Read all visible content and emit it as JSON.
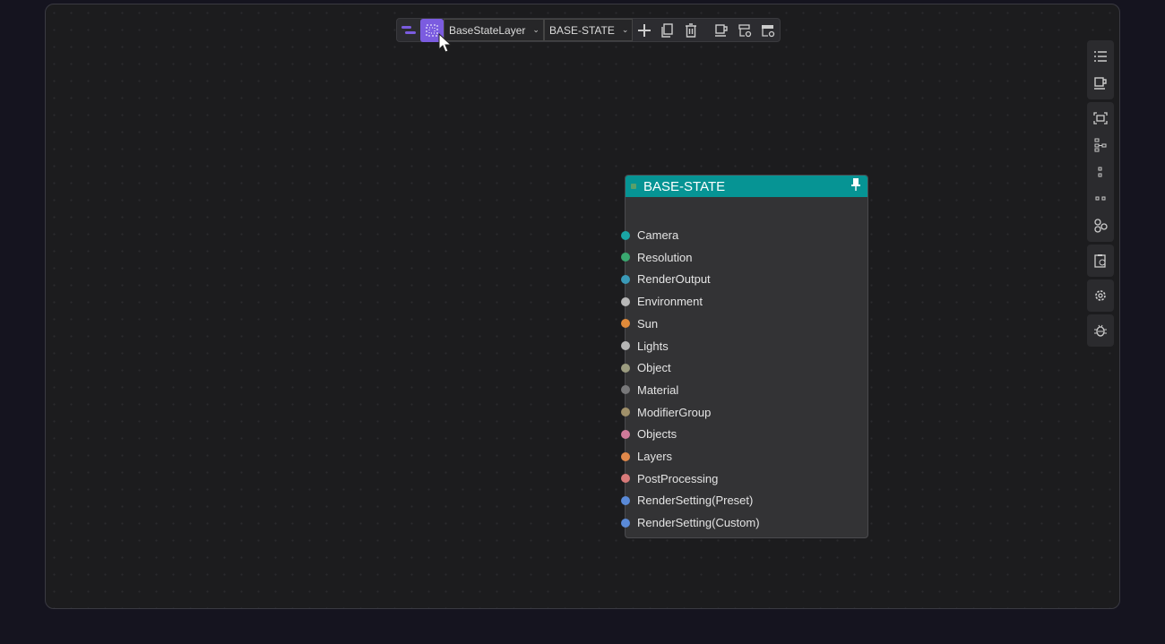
{
  "toolbar": {
    "layer_select": "BaseStateLayer",
    "state_select": "BASE-STATE",
    "icons": [
      "layers-icon",
      "select-area-icon",
      "add-icon",
      "copy-icon",
      "delete-icon",
      "preview-icon",
      "render-queue-icon",
      "archive-icon"
    ]
  },
  "node": {
    "title": "BASE-STATE",
    "ports": [
      {
        "label": "Camera",
        "color": "#1aa5a5"
      },
      {
        "label": "Resolution",
        "color": "#3aa870"
      },
      {
        "label": "RenderOutput",
        "color": "#3a9ab8"
      },
      {
        "label": "Environment",
        "color": "#b8b8b8"
      },
      {
        "label": "Sun",
        "color": "#e08a3a"
      },
      {
        "label": "Lights",
        "color": "#b5b5b5"
      },
      {
        "label": "Object",
        "color": "#9c9c80"
      },
      {
        "label": "Material",
        "color": "#78787a"
      },
      {
        "label": "ModifierGroup",
        "color": "#a0906a"
      },
      {
        "label": "Objects",
        "color": "#d07a9a"
      },
      {
        "label": "Layers",
        "color": "#e0884a"
      },
      {
        "label": "PostProcessing",
        "color": "#d87a7a"
      },
      {
        "label": "RenderSetting(Preset)",
        "color": "#5a8ad8"
      },
      {
        "label": "RenderSetting(Custom)",
        "color": "#5a8ad8"
      }
    ]
  },
  "accent": "#7b5ce0",
  "header_color": "#069494"
}
